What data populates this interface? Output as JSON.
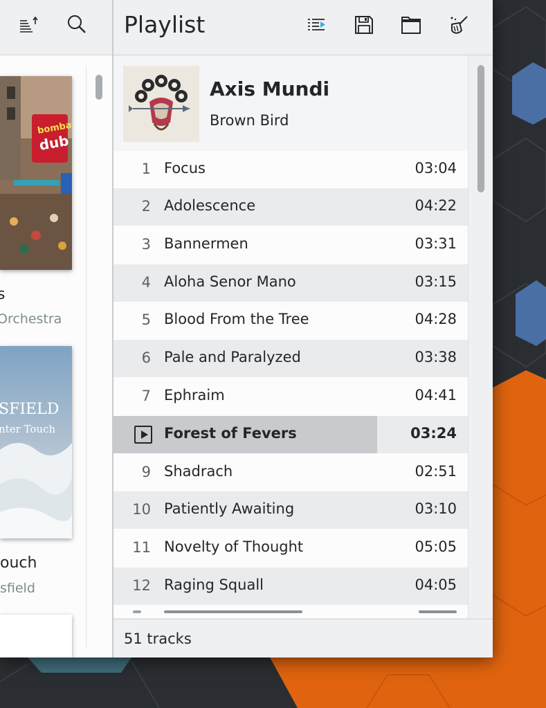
{
  "colors": {
    "accent_blue": "#4a6fa5",
    "accent_orange": "#e0640f",
    "playing_row": "#c8cacd"
  },
  "library": {
    "toolbar": {
      "sort_icon": "sort-ascending-icon",
      "search_icon": "search-icon"
    },
    "albums": [
      {
        "title": "s",
        "artist": "Orchestra",
        "cover_text_1": "bombay",
        "cover_text_2": "dub"
      },
      {
        "title": "ouch",
        "artist": "sfield",
        "cover_text_1": "SFIELD",
        "cover_text_2": "nter Touch"
      }
    ]
  },
  "playlist": {
    "title": "Playlist",
    "toolbar": {
      "queue_icon": "playlist-queue-icon",
      "save_icon": "save-icon",
      "open_icon": "folder-icon",
      "clear_icon": "clear-playlist-icon"
    },
    "album": {
      "name": "Axis Mundi",
      "artist": "Brown Bird"
    },
    "tracks": [
      {
        "num": "1",
        "name": "Focus",
        "duration": "03:04"
      },
      {
        "num": "2",
        "name": "Adolescence",
        "duration": "04:22"
      },
      {
        "num": "3",
        "name": "Bannermen",
        "duration": "03:31"
      },
      {
        "num": "4",
        "name": "Aloha Senor Mano",
        "duration": "03:15"
      },
      {
        "num": "5",
        "name": "Blood From the Tree",
        "duration": "04:28"
      },
      {
        "num": "6",
        "name": "Pale and Paralyzed",
        "duration": "03:38"
      },
      {
        "num": "7",
        "name": "Ephraim",
        "duration": "04:41"
      },
      {
        "num": "",
        "name": "Forest of Fevers",
        "duration": "03:24",
        "playing": true
      },
      {
        "num": "9",
        "name": "Shadrach",
        "duration": "02:51"
      },
      {
        "num": "10",
        "name": "Patiently Awaiting",
        "duration": "03:10"
      },
      {
        "num": "11",
        "name": "Novelty of Thought",
        "duration": "05:05"
      },
      {
        "num": "12",
        "name": "Raging Squall",
        "duration": "04:05"
      }
    ],
    "footer": "51 tracks"
  }
}
